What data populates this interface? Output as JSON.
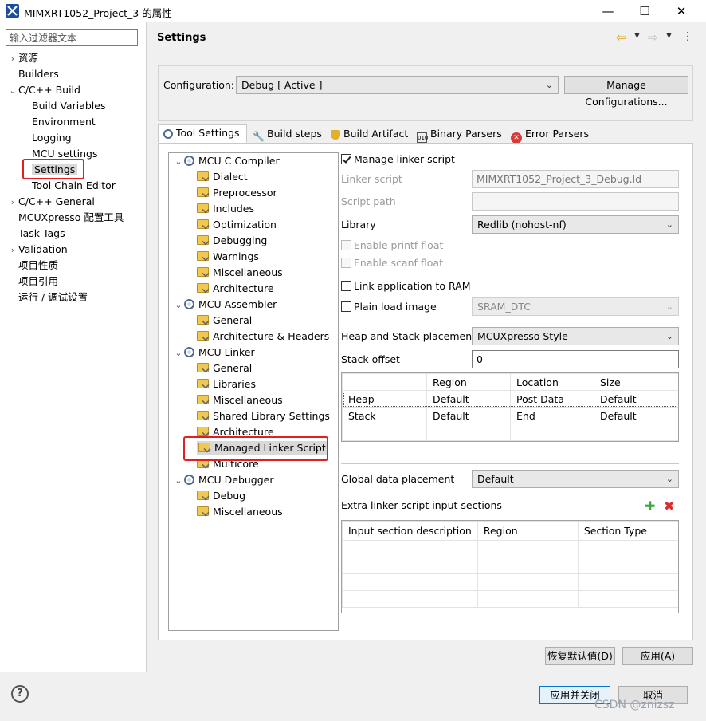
{
  "window": {
    "title": "MIMXRT1052_Project_3 的属性",
    "minimize_icon": "minimize-icon",
    "maximize_icon": "maximize-icon",
    "close_icon": "close-icon"
  },
  "filter": {
    "placeholder": "输入过滤器文本"
  },
  "nav": [
    {
      "label": "资源",
      "arrow": "›"
    },
    {
      "label": "Builders",
      "arrow": ""
    },
    {
      "label": "C/C++ Build",
      "arrow": "⌄"
    },
    {
      "label": "Build Variables",
      "arrow": ""
    },
    {
      "label": "Environment",
      "arrow": ""
    },
    {
      "label": "Logging",
      "arrow": ""
    },
    {
      "label": "MCU settings",
      "arrow": ""
    },
    {
      "label": "Settings",
      "arrow": ""
    },
    {
      "label": "Tool Chain Editor",
      "arrow": ""
    },
    {
      "label": "C/C++ General",
      "arrow": "›"
    },
    {
      "label": "MCUXpresso 配置工具",
      "arrow": ""
    },
    {
      "label": "Task Tags",
      "arrow": ""
    },
    {
      "label": "Validation",
      "arrow": "›"
    },
    {
      "label": "项目性质",
      "arrow": ""
    },
    {
      "label": "项目引用",
      "arrow": ""
    },
    {
      "label": "运行 / 调试设置",
      "arrow": ""
    }
  ],
  "header": {
    "title": "Settings"
  },
  "configuration": {
    "label": "Configuration:",
    "value": "Debug  [ Active ]",
    "manage_button": "Manage Configurations..."
  },
  "tabs": [
    {
      "label": "Tool Settings"
    },
    {
      "label": "Build steps"
    },
    {
      "label": "Build Artifact"
    },
    {
      "label": "Binary Parsers"
    },
    {
      "label": "Error Parsers"
    }
  ],
  "tree": {
    "c_compiler": {
      "label": "MCU C Compiler",
      "children": [
        "Dialect",
        "Preprocessor",
        "Includes",
        "Optimization",
        "Debugging",
        "Warnings",
        "Miscellaneous",
        "Architecture"
      ]
    },
    "assembler": {
      "label": "MCU Assembler",
      "children": [
        "General",
        "Architecture & Headers"
      ]
    },
    "linker": {
      "label": "MCU Linker",
      "children": [
        "General",
        "Libraries",
        "Miscellaneous",
        "Shared Library Settings",
        "Architecture",
        "Managed Linker Script",
        "Multicore"
      ]
    },
    "debugger": {
      "label": "MCU Debugger",
      "children": [
        "Debug",
        "Miscellaneous"
      ]
    }
  },
  "form": {
    "manage_linker_script": "Manage linker script",
    "linker_script_label": "Linker script",
    "linker_script_value": "MIMXRT1052_Project_3_Debug.ld",
    "script_path_label": "Script path",
    "library_label": "Library",
    "library_value": "Redlib (nohost-nf)",
    "enable_printf_float": "Enable printf float",
    "enable_scanf_float": "Enable scanf float",
    "link_to_ram": "Link application to RAM",
    "plain_load_image": "Plain load image",
    "plain_load_value": "SRAM_DTC",
    "heap_stack_label": "Heap and Stack placement",
    "heap_stack_value": "MCUXpresso Style",
    "stack_offset_label": "Stack offset",
    "stack_offset_value": "0",
    "global_data_label": "Global data placement",
    "global_data_value": "Default",
    "extra_sections_label": "Extra linker script input sections"
  },
  "heap_table": {
    "headers": [
      "",
      "Region",
      "Location",
      "Size"
    ],
    "rows": [
      [
        "Heap",
        "Default",
        "Post Data",
        "Default"
      ],
      [
        "Stack",
        "Default",
        "End",
        "Default"
      ]
    ]
  },
  "sections_table": {
    "headers": [
      "Input section description",
      "Region",
      "Section Type"
    ]
  },
  "buttons": {
    "restore_defaults": "恢复默认值(D)",
    "apply": "应用(A)",
    "apply_close": "应用并关闭",
    "cancel": "取消"
  },
  "watermark": "CSDN @znizsz"
}
